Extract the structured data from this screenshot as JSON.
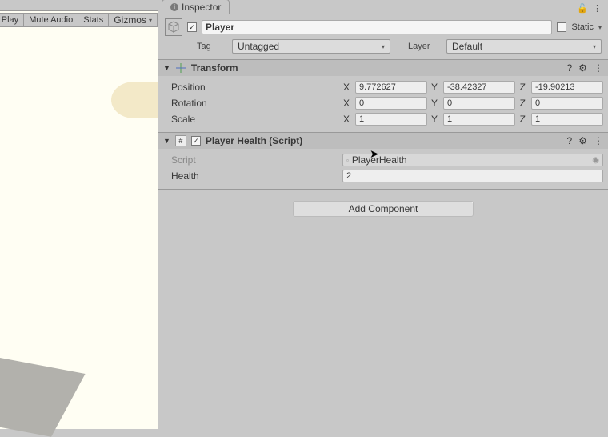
{
  "left_toolbar": {
    "play": "Play",
    "mute": "Mute Audio",
    "stats": "Stats",
    "gizmos": "Gizmos"
  },
  "inspector_tab": "Inspector",
  "header": {
    "enabled": true,
    "name": "Player",
    "static_label": "Static",
    "tag_label": "Tag",
    "tag_value": "Untagged",
    "layer_label": "Layer",
    "layer_value": "Default"
  },
  "transform": {
    "title": "Transform",
    "rows": [
      {
        "label": "Position",
        "x": "9.772627",
        "y": "-38.42327",
        "z": "-19.90213"
      },
      {
        "label": "Rotation",
        "x": "0",
        "y": "0",
        "z": "0"
      },
      {
        "label": "Scale",
        "x": "1",
        "y": "1",
        "z": "1"
      }
    ]
  },
  "playerHealth": {
    "title": "Player Health (Script)",
    "script_label": "Script",
    "script_value": "PlayerHealth",
    "health_label": "Health",
    "health_value": "2"
  },
  "add_component": "Add Component"
}
